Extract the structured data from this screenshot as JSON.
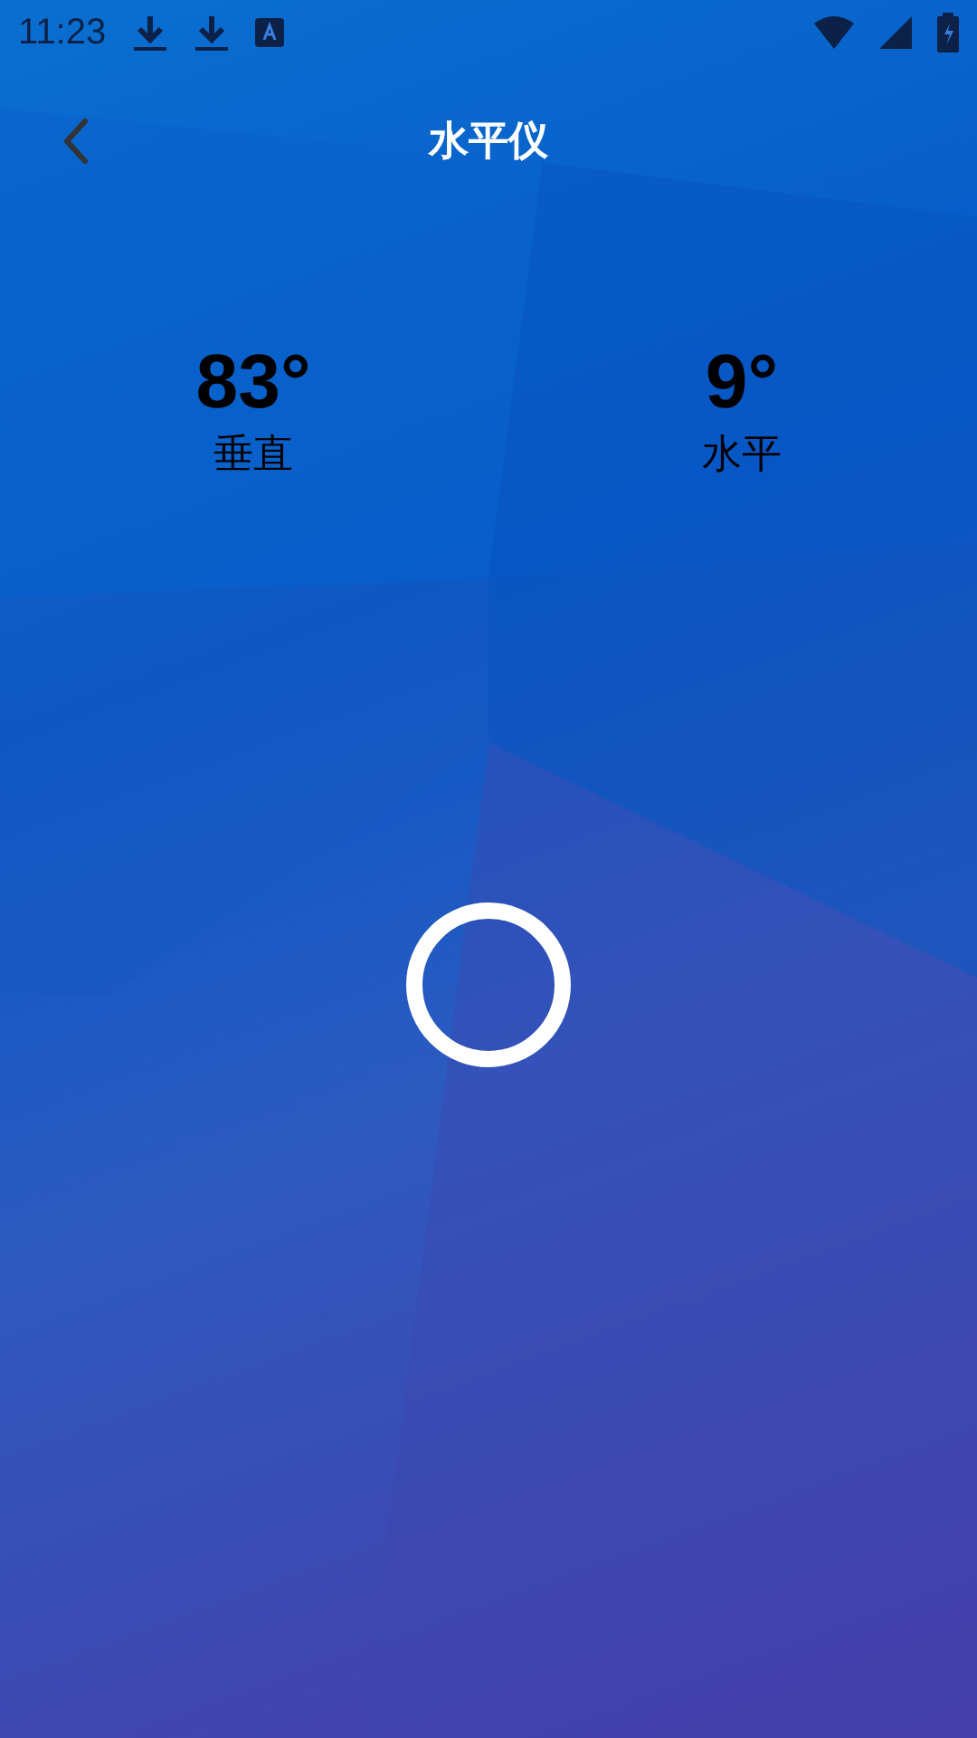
{
  "status_bar": {
    "time": "11:23"
  },
  "header": {
    "title": "水平仪"
  },
  "readings": [
    {
      "value": "83°",
      "label": "垂直"
    },
    {
      "value": "9°",
      "label": "水平"
    }
  ]
}
